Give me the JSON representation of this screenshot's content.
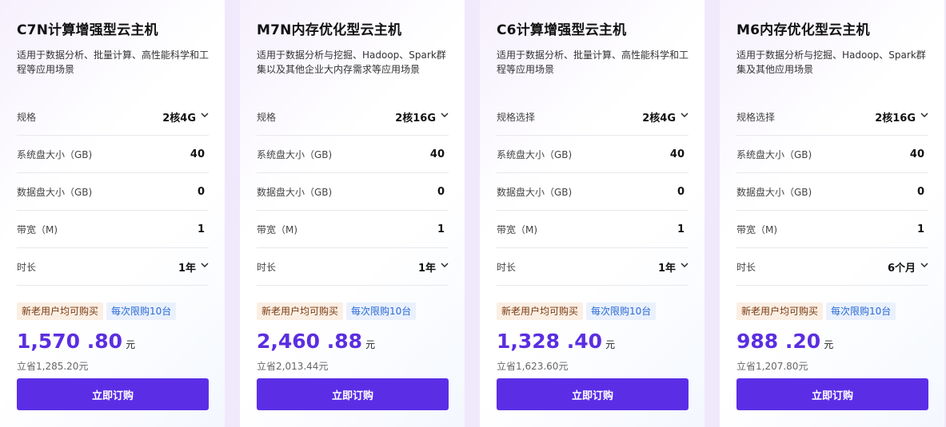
{
  "cards": [
    {
      "title": "C7N计算增强型云主机",
      "desc": "适用于数据分析、批量计算、高性能科学和工程等应用场景",
      "rows": [
        {
          "label": "规格",
          "value": "2核4G"
        },
        {
          "label": "系统盘大小（GB)",
          "value": "40"
        },
        {
          "label": "数据盘大小（GB)",
          "value": "0"
        },
        {
          "label": "带宽（M)",
          "value": "1"
        },
        {
          "label": "时长",
          "value": "1年"
        }
      ],
      "badge_new": "新老用户均可购买",
      "badge_limit": "每次限购10台",
      "price": "1,570 .80",
      "price_unit": "元",
      "save": "立省1,285.20元",
      "buy": "立即订购"
    },
    {
      "title": "M7N内存优化型云主机",
      "desc": "适用于数据分析与挖掘、Hadoop、Spark群集以及其他企业大内存需求等应用场景",
      "rows": [
        {
          "label": "规格",
          "value": "2核16G"
        },
        {
          "label": "系统盘大小（GB)",
          "value": "40"
        },
        {
          "label": "数据盘大小（GB)",
          "value": "0"
        },
        {
          "label": "带宽（M)",
          "value": "1"
        },
        {
          "label": "时长",
          "value": "1年"
        }
      ],
      "badge_new": "新老用户均可购买",
      "badge_limit": "每次限购10台",
      "price": "2,460 .88",
      "price_unit": "元",
      "save": "立省2,013.44元",
      "buy": "立即订购"
    },
    {
      "title": "C6计算增强型云主机",
      "desc": "适用于数据分析、批量计算、高性能科学和工程等应用场景",
      "rows": [
        {
          "label": "规格选择",
          "value": "2核4G"
        },
        {
          "label": "系统盘大小（GB)",
          "value": "40"
        },
        {
          "label": "数据盘大小（GB)",
          "value": "0"
        },
        {
          "label": "带宽（M)",
          "value": "1"
        },
        {
          "label": "时长",
          "value": "1年"
        }
      ],
      "badge_new": "新老用户均可购买",
      "badge_limit": "每次限购10台",
      "price": "1,328 .40",
      "price_unit": "元",
      "save": "立省1,623.60元",
      "buy": "立即订购"
    },
    {
      "title": "M6内存优化型云主机",
      "desc": "适用于数据分析与挖掘、Hadoop、Spark群集及其他应用场景",
      "rows": [
        {
          "label": "规格选择",
          "value": "2核16G"
        },
        {
          "label": "系统盘大小（GB)",
          "value": "40"
        },
        {
          "label": "数据盘大小（GB)",
          "value": "0"
        },
        {
          "label": "带宽（M)",
          "value": "1"
        },
        {
          "label": "时长",
          "value": "6个月"
        }
      ],
      "badge_new": "新老用户均可购买",
      "badge_limit": "每次限购10台",
      "price": "988 .20",
      "price_unit": "元",
      "save": "立省1,207.80元",
      "buy": "立即订购"
    }
  ],
  "icons": {
    "dropdown": "chevron-down-icon"
  },
  "colors": {
    "accent": "#5b2ee6",
    "price": "#5b2ee0",
    "badge_orange_bg": "#fbeee3",
    "badge_blue_bg": "#eaf1fc"
  }
}
